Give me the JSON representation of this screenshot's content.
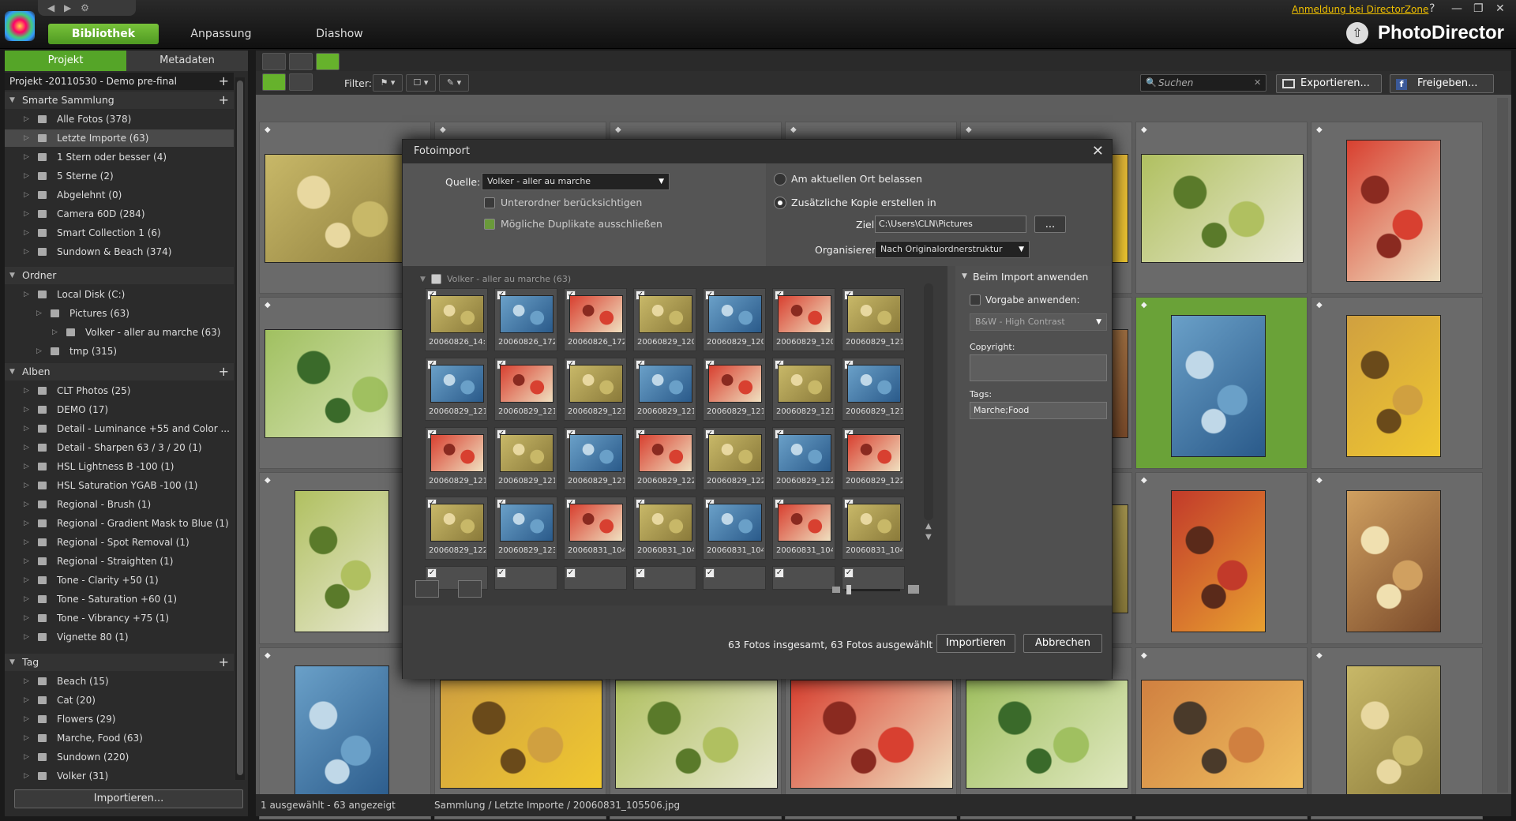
{
  "topbar": {
    "modes": [
      "Bibliothek",
      "Anpassung",
      "Diashow"
    ],
    "dz_link": "Anmeldung bei DirectorZone",
    "help": "?",
    "brand": "PhotoDirector"
  },
  "left": {
    "tabs": [
      "Projekt",
      "Metadaten"
    ],
    "project": "Projekt -20110530 - Demo pre-final",
    "smart_title": "Smarte Sammlung",
    "smart": [
      "Alle Fotos (378)",
      "Letzte Importe (63)",
      "1 Stern oder besser (4)",
      "5 Sterne (2)",
      "Abgelehnt (0)",
      "Camera 60D (284)",
      "Smart Collection 1 (6)",
      "Sundown & Beach (374)"
    ],
    "folder_title": "Ordner",
    "folders": [
      "Local Disk (C:)",
      "Pictures (63)",
      "Volker - aller au marche (63)",
      "tmp (315)"
    ],
    "album_title": "Alben",
    "albums": [
      "CLT Photos (25)",
      "DEMO (17)",
      "Detail - Luminance +55 and Color ...",
      "Detail - Sharpen 63 / 3 / 20 (1)",
      "HSL Lightness B -100 (1)",
      "HSL Saturation YGAB -100 (1)",
      "Regional - Brush (1)",
      "Regional - Gradient Mask to Blue (1)",
      "Regional - Spot Removal (1)",
      "Regional - Straighten (1)",
      "Tone - Clarity +50 (1)",
      "Tone - Saturation +60 (1)",
      "Tone - Vibrancy +75 (1)",
      "Vignette 80 (1)"
    ],
    "tag_title": "Tag",
    "tags": [
      "Beach (15)",
      "Cat (20)",
      "Flowers (29)",
      "Marche, Food (63)",
      "Sundown (220)",
      "Volker (31)"
    ],
    "import_btn": "Importieren..."
  },
  "toolbar": {
    "filter_label": "Filter:",
    "search_placeholder": "Suchen",
    "export": "Exportieren...",
    "share": "Freigeben..."
  },
  "status": {
    "left": "1 ausgewählt - 63 angezeigt",
    "path": "Sammlung / Letzte Importe / 20060831_105506.jpg"
  },
  "dialog": {
    "title": "Fotoimport",
    "source_label": "Quelle:",
    "source_value": "Volker - aller au marche",
    "subfolders": "Unterordner berücksichtigen",
    "duplicates": "Mögliche Duplikate ausschließen",
    "keep": "Am aktuellen Ort belassen",
    "copy": "Zusätzliche Kopie erstellen in",
    "target_label": "Ziel:",
    "target_value": "C:\\Users\\CLN\\Pictures",
    "browse": "...",
    "org_label": "Organisieren:",
    "org_value": "Nach Originalordnerstruktur",
    "group_header": "Volker - aller au marche (63)",
    "thumbs": [
      "20060826_14:",
      "20060826_172",
      "20060826_172",
      "20060829_120",
      "20060829_120",
      "20060829_120",
      "20060829_121",
      "20060829_121",
      "20060829_121",
      "20060829_121",
      "20060829_121",
      "20060829_121",
      "20060829_121",
      "20060829_121",
      "20060829_121",
      "20060829_121",
      "20060829_121",
      "20060829_122",
      "20060829_122",
      "20060829_122",
      "20060829_122",
      "20060829_122",
      "20060829_123",
      "20060831_104",
      "20060831_104",
      "20060831_104",
      "20060831_104",
      "20060831_104"
    ],
    "apply_title": "Beim Import anwenden",
    "preset_label": "Vorgabe anwenden:",
    "preset_value": "B&W - High Contrast",
    "copyright_label": "Copyright:",
    "tags_label": "Tags:",
    "tags_value": "Marche;Food",
    "summary": "63 Fotos insgesamt, 63 Fotos ausgewählt",
    "import": "Importieren",
    "cancel": "Abbrechen"
  },
  "colors": {
    "accent": "#66b22c",
    "dz": "#f0c000"
  }
}
